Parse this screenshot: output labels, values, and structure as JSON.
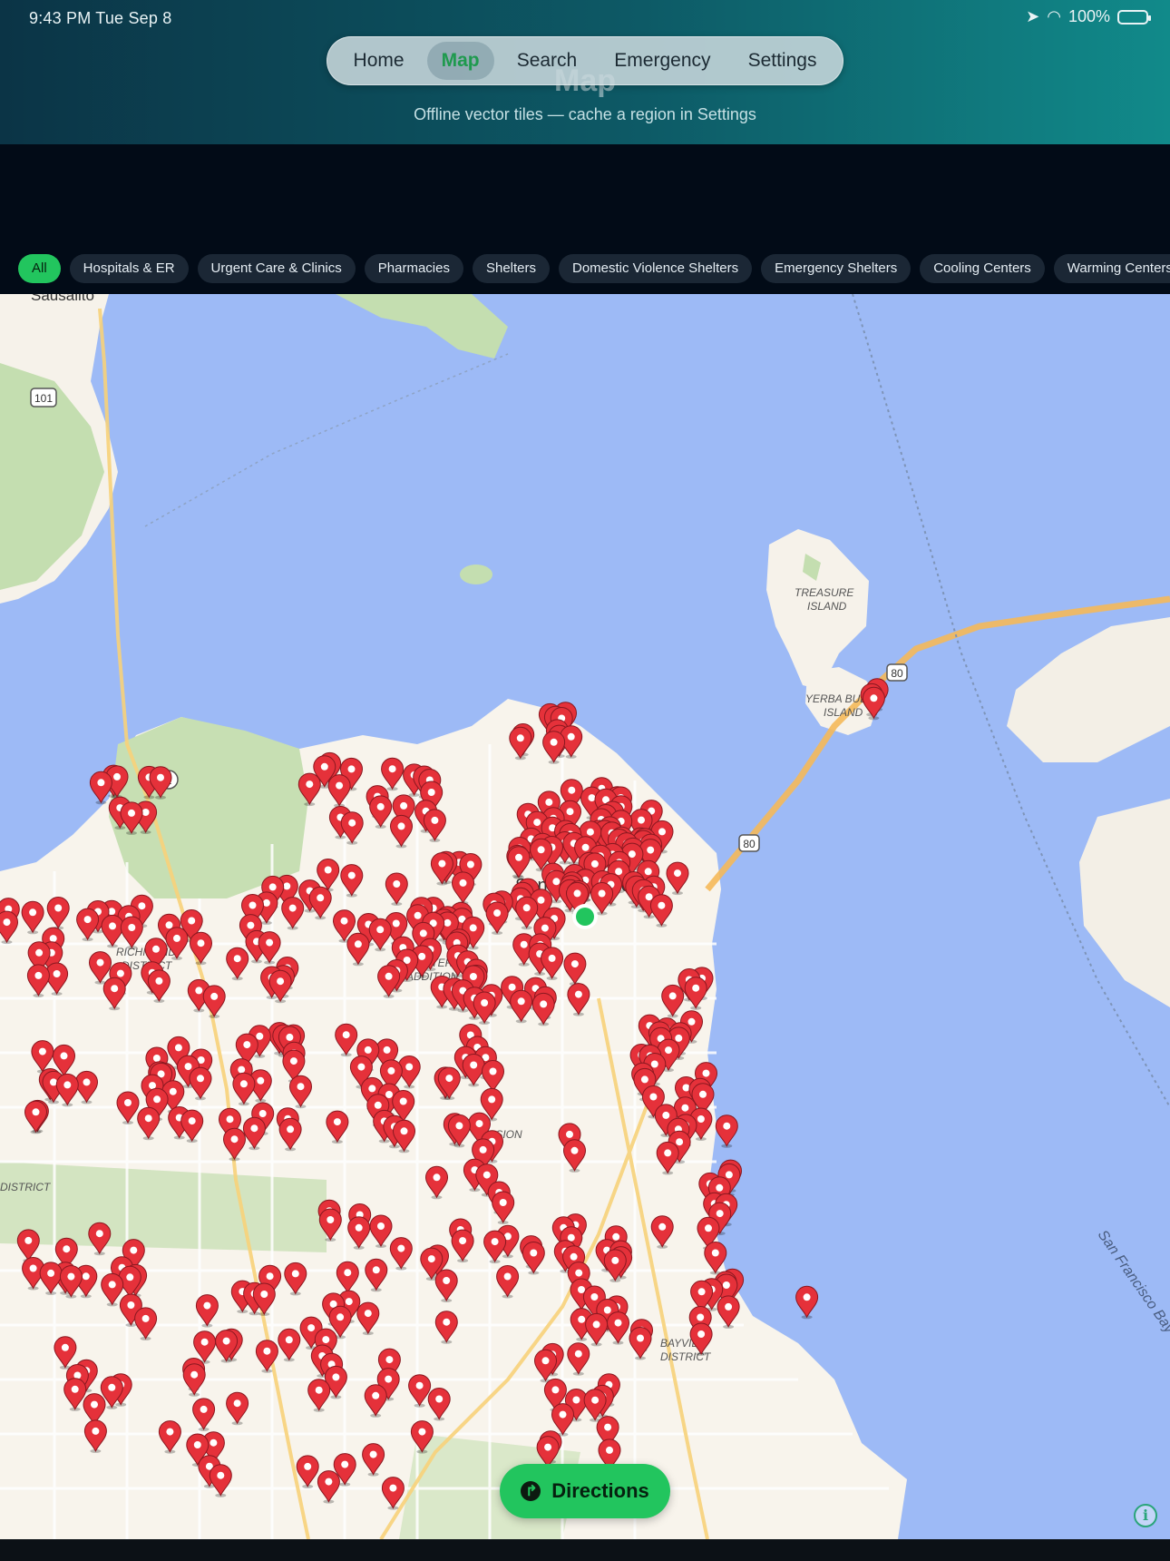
{
  "status_bar": {
    "time": "9:43 PM   Tue Sep 8",
    "battery": "100%"
  },
  "header": {
    "title": "Map",
    "subtitle": "Offline vector tiles — cache a region in Settings"
  },
  "nav": {
    "tabs": [
      {
        "label": "Home",
        "active": false
      },
      {
        "label": "Map",
        "active": true
      },
      {
        "label": "Search",
        "active": false
      },
      {
        "label": "Emergency",
        "active": false
      },
      {
        "label": "Settings",
        "active": false
      }
    ]
  },
  "filters": {
    "chips": [
      {
        "label": "All",
        "active": true
      },
      {
        "label": "Hospitals & ER",
        "active": false
      },
      {
        "label": "Urgent Care & Clinics",
        "active": false
      },
      {
        "label": "Pharmacies",
        "active": false
      },
      {
        "label": "Shelters",
        "active": false
      },
      {
        "label": "Domestic Violence Shelters",
        "active": false
      },
      {
        "label": "Emergency Shelters",
        "active": false
      },
      {
        "label": "Cooling Centers",
        "active": false
      },
      {
        "label": "Warming Centers",
        "active": false
      }
    ]
  },
  "map": {
    "labels": {
      "sausalito": "Sausalito",
      "treasure_island": "TREASURE",
      "treasure_island_2": "ISLAND",
      "yerba_buena": "YERBA BUENA",
      "yerba_buena_2": "ISLAND",
      "richmond": "RICHMOND",
      "richmond_2": "DISTRICT",
      "western_addition": "WESTERN",
      "western_addition_2": "ADDITION",
      "mission": "MISSION",
      "bayview": "BAYVIEW",
      "bayview_2": "DISTRICT",
      "sunset": "DISTRICT",
      "city": "San Francisco",
      "bay": "San Francisco Bay"
    },
    "shields": {
      "us101": "101",
      "ca1": "1",
      "i80": "80"
    },
    "colors": {
      "water": "#9dbaf6",
      "land": "#f8f4ec",
      "park": "#c7dfb3",
      "pin": "#e5313a",
      "user": "#22c55e"
    }
  },
  "actions": {
    "directions": "Directions",
    "info": "i"
  }
}
